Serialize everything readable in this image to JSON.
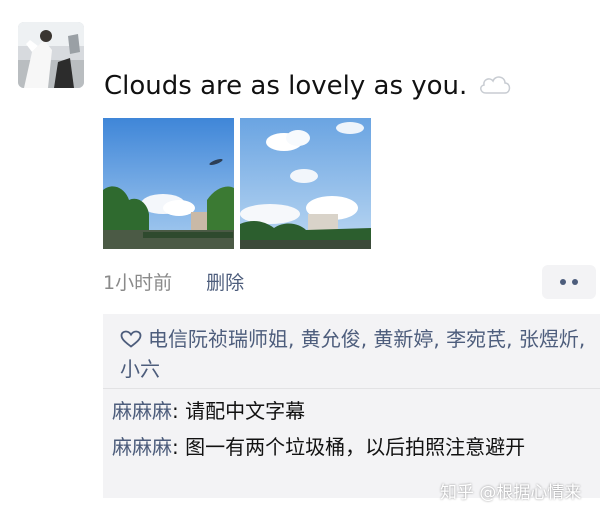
{
  "post": {
    "text": "Clouds are as lovely as you.",
    "emoji_icon": "cloud-icon",
    "photo_count": 2,
    "time_ago": "1小时前",
    "delete_label": "删除",
    "more_icon": "more-dots-icon"
  },
  "likes": {
    "icon": "heart-outline-icon",
    "names": "电信阮祯瑞师姐, 黄允俊, 黄新婷, 李宛芪, 张煜炘, 小六"
  },
  "comments": [
    {
      "author": "麻麻麻",
      "separator": ": ",
      "text": "请配中文字幕"
    },
    {
      "author": "麻麻麻",
      "separator": ": ",
      "text": "图一有两个垃圾桶，以后拍照注意避开"
    }
  ],
  "watermark": "知乎 @根据心情来",
  "colors": {
    "link_blue": "#4d5d7c",
    "meta_gray": "#8a8a8a",
    "comment_bg": "#f3f3f5"
  }
}
